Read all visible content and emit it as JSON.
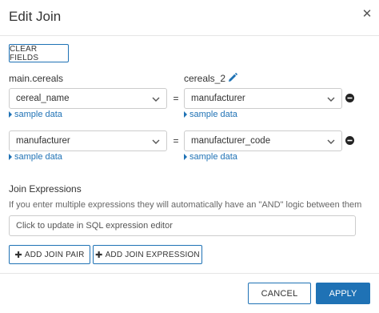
{
  "dialog": {
    "title": "Edit Join",
    "close_icon": "close-icon"
  },
  "toolbar": {
    "clear_fields_label": "CLEAR FIELDS"
  },
  "tables": {
    "left_name": "main.cereals",
    "right_name": "cereals_2",
    "edit_icon": "pencil-icon"
  },
  "join_pairs": [
    {
      "left": "cereal_name",
      "operator": "=",
      "right": "manufacturer",
      "left_link": "sample data",
      "right_link": "sample data"
    },
    {
      "left": "manufacturer",
      "operator": "=",
      "right": "manufacturer_code",
      "left_link": "sample data",
      "right_link": "sample data"
    }
  ],
  "expressions": {
    "title": "Join Expressions",
    "help": "If you enter multiple expressions they will automatically have an \"AND\" logic between them",
    "placeholder": "Click to update in SQL expression editor"
  },
  "actions": {
    "add_pair_label": "ADD JOIN PAIR",
    "add_expression_label": "ADD JOIN EXPRESSION",
    "cancel_label": "CANCEL",
    "apply_label": "APPLY"
  },
  "colors": {
    "accent": "#1f72b5",
    "border": "#cccccc",
    "text": "#333333"
  }
}
